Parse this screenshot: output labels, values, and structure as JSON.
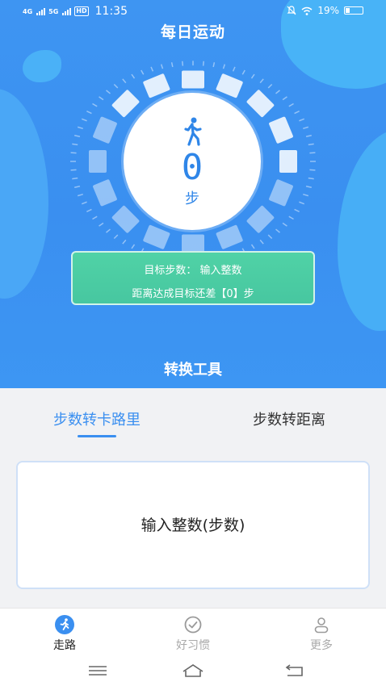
{
  "status_bar": {
    "network_1": "4G",
    "network_2": "5G",
    "hd": "HD",
    "time": "11:35",
    "battery": "19%"
  },
  "header": {
    "title": "每日运动"
  },
  "steps": {
    "count": "0",
    "unit": "步"
  },
  "target": {
    "line1": "目标步数：  输入整数",
    "line2": "距离达成目标还差【0】步"
  },
  "tools": {
    "title": "转换工具",
    "tabs": [
      {
        "label": "步数转卡路里",
        "active": true
      },
      {
        "label": "步数转距离",
        "active": false
      }
    ],
    "input_placeholder": "输入整数(步数)"
  },
  "bottom_nav": {
    "items": [
      {
        "label": "走路",
        "icon": "runner-icon",
        "active": true
      },
      {
        "label": "好习惯",
        "icon": "check-circle-icon",
        "active": false
      },
      {
        "label": "更多",
        "icon": "user-icon",
        "active": false
      }
    ]
  },
  "colors": {
    "primary": "#3a8ff0",
    "accent_green": "#4ccda3",
    "inactive": "#aaaaaa"
  }
}
